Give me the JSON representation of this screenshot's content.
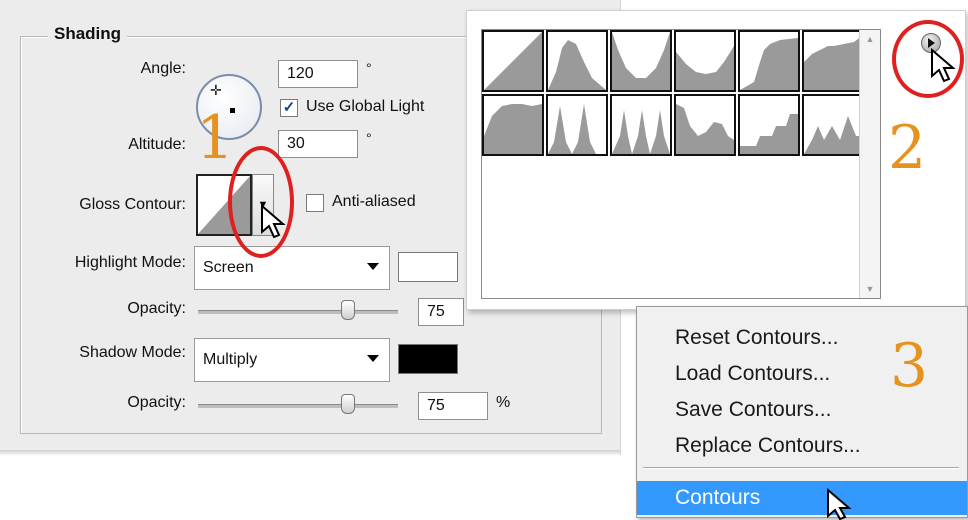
{
  "shading": {
    "title": "Shading",
    "angle_label": "Angle:",
    "angle_value": "120",
    "degree_symbol": "°",
    "use_global_light_label": "Use Global Light",
    "use_global_light_checked": true,
    "altitude_label": "Altitude:",
    "altitude_value": "30",
    "gloss_contour_label": "Gloss Contour:",
    "anti_aliased_label": "Anti-aliased",
    "anti_aliased_checked": false,
    "highlight_mode_label": "Highlight Mode:",
    "highlight_mode_value": "Screen",
    "highlight_color": "#ffffff",
    "highlight_opacity_label": "Opacity:",
    "highlight_opacity_value": "75",
    "highlight_opacity_fraction": 0.75,
    "shadow_mode_label": "Shadow Mode:",
    "shadow_mode_value": "Multiply",
    "shadow_color": "#000000",
    "shadow_opacity_label": "Opacity:",
    "shadow_opacity_value": "75",
    "shadow_opacity_fraction": 0.75,
    "percent_symbol": "%"
  },
  "contour_picker": {
    "presets": [
      "linear-icon",
      "cone-icon",
      "cove-deep-icon",
      "cove-shallow-icon",
      "gaussian-icon",
      "half-round-icon",
      "ring-icon",
      "ring-double-icon",
      "rolling-slope-icon",
      "rounded-steps-icon",
      "sawtooth-icon",
      "ring-triple-icon"
    ],
    "menu_button_icon": "flyout-menu-icon"
  },
  "flyout_menu": {
    "items": [
      "Reset Contours...",
      "Load Contours...",
      "Save Contours...",
      "Replace Contours..."
    ],
    "selected_item": "Contours"
  },
  "annotations": {
    "step1": "1",
    "step2": "2",
    "step3": "3",
    "highlight_color": "#e01f1f",
    "number_color": "#e6921f"
  }
}
